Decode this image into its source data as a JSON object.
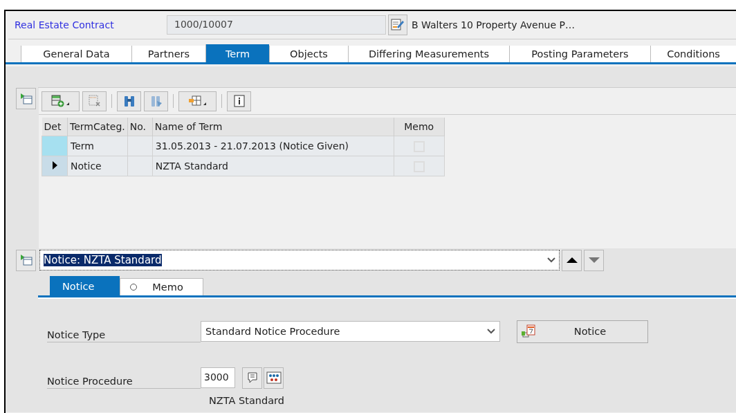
{
  "header": {
    "label": "Real Estate Contract",
    "contract_number": "1000/10007",
    "description": "B Walters 10 Property Avenue P…"
  },
  "tabs": [
    {
      "label": "General Data",
      "selected": false
    },
    {
      "label": "Partners",
      "selected": false
    },
    {
      "label": "Term",
      "selected": true
    },
    {
      "label": "Objects",
      "selected": false
    },
    {
      "label": "Differing Measurements",
      "selected": false
    },
    {
      "label": "Posting Parameters",
      "selected": false
    },
    {
      "label": "Conditions",
      "selected": false
    }
  ],
  "table": {
    "columns": [
      "Det",
      "TermCateg.",
      "No.",
      "Name of Term",
      "Memo"
    ],
    "rows": [
      {
        "category": "Term",
        "name": "31.05.2013 - 21.07.2013 (Notice Given)",
        "memo": false,
        "selected": false,
        "current": false
      },
      {
        "category": "Notice",
        "name": "NZTA Standard",
        "memo": false,
        "selected": false,
        "current": true
      }
    ]
  },
  "detail_selector": {
    "value": "Notice: NZTA Standard"
  },
  "subtabs": [
    {
      "label": "Notice",
      "selected": true,
      "kind": "plain"
    },
    {
      "label": "Memo",
      "selected": false,
      "kind": "circled"
    }
  ],
  "form": {
    "notice_type_label": "Notice Type",
    "notice_type": "Standard Notice Procedure",
    "notice_button": "Notice",
    "procedure_label": "Notice Procedure",
    "procedure": "3000",
    "procedure_name": "NZTA Standard"
  }
}
